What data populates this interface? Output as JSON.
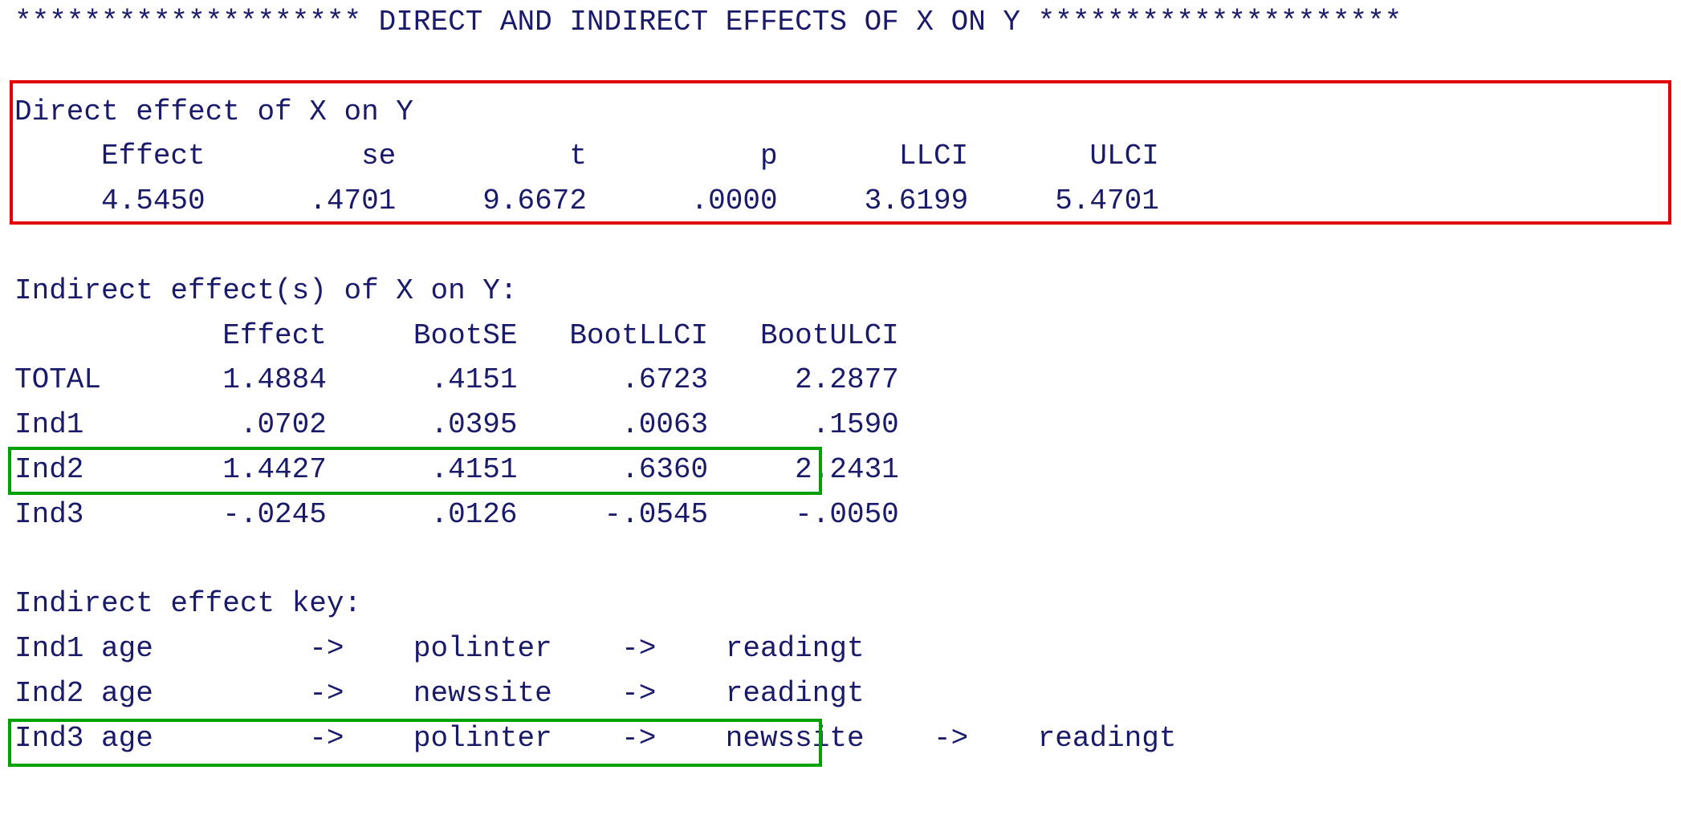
{
  "header": {
    "star_line": "******************** DIRECT AND INDIRECT EFFECTS OF X ON Y *********************"
  },
  "direct": {
    "title": "Direct effect of X on Y",
    "columns": "     Effect         se          t          p       LLCI       ULCI",
    "row": "     4.5450      .4701     9.6672      .0000     3.6199     5.4701"
  },
  "indirect": {
    "title": "Indirect effect(s) of X on Y:",
    "columns": "            Effect     BootSE   BootLLCI   BootULCI",
    "rows": {
      "total": "TOTAL       1.4884      .4151      .6723     2.2877",
      "ind1": "Ind1         .0702      .0395      .0063      .1590",
      "ind2": "Ind2        1.4427      .4151      .6360     2.2431",
      "ind3": "Ind3        -.0245      .0126     -.0545     -.0050"
    }
  },
  "key": {
    "title": "Indirect effect key:",
    "rows": {
      "ind1": "Ind1 age         ->    polinter    ->    readingt",
      "ind2": "Ind2 age         ->    newssite    ->    readingt",
      "ind3": "Ind3 age         ->    polinter    ->    newssite    ->    readingt"
    }
  },
  "chart_data": {
    "type": "table",
    "title": "DIRECT AND INDIRECT EFFECTS OF X ON Y",
    "direct_effect": {
      "columns": [
        "Effect",
        "se",
        "t",
        "p",
        "LLCI",
        "ULCI"
      ],
      "values": [
        4.545,
        0.4701,
        9.6672,
        0.0,
        3.6199,
        5.4701
      ]
    },
    "indirect_effects": {
      "columns": [
        "Effect",
        "BootSE",
        "BootLLCI",
        "BootULCI"
      ],
      "rows": [
        {
          "name": "TOTAL",
          "values": [
            1.4884,
            0.4151,
            0.6723,
            2.2877
          ]
        },
        {
          "name": "Ind1",
          "values": [
            0.0702,
            0.0395,
            0.0063,
            0.159
          ]
        },
        {
          "name": "Ind2",
          "values": [
            1.4427,
            0.4151,
            0.636,
            2.2431
          ]
        },
        {
          "name": "Ind3",
          "values": [
            -0.0245,
            0.0126,
            -0.0545,
            -0.005
          ]
        }
      ]
    },
    "indirect_effect_key": [
      {
        "name": "Ind1",
        "path": [
          "age",
          "polinter",
          "readingt"
        ]
      },
      {
        "name": "Ind2",
        "path": [
          "age",
          "newssite",
          "readingt"
        ]
      },
      {
        "name": "Ind3",
        "path": [
          "age",
          "polinter",
          "newssite",
          "readingt"
        ]
      }
    ],
    "highlights": {
      "red_box": "Direct effect of X on Y block",
      "green_boxes": [
        "Ind2 row in indirect effects table",
        "Ind2 row in indirect effect key"
      ]
    }
  }
}
